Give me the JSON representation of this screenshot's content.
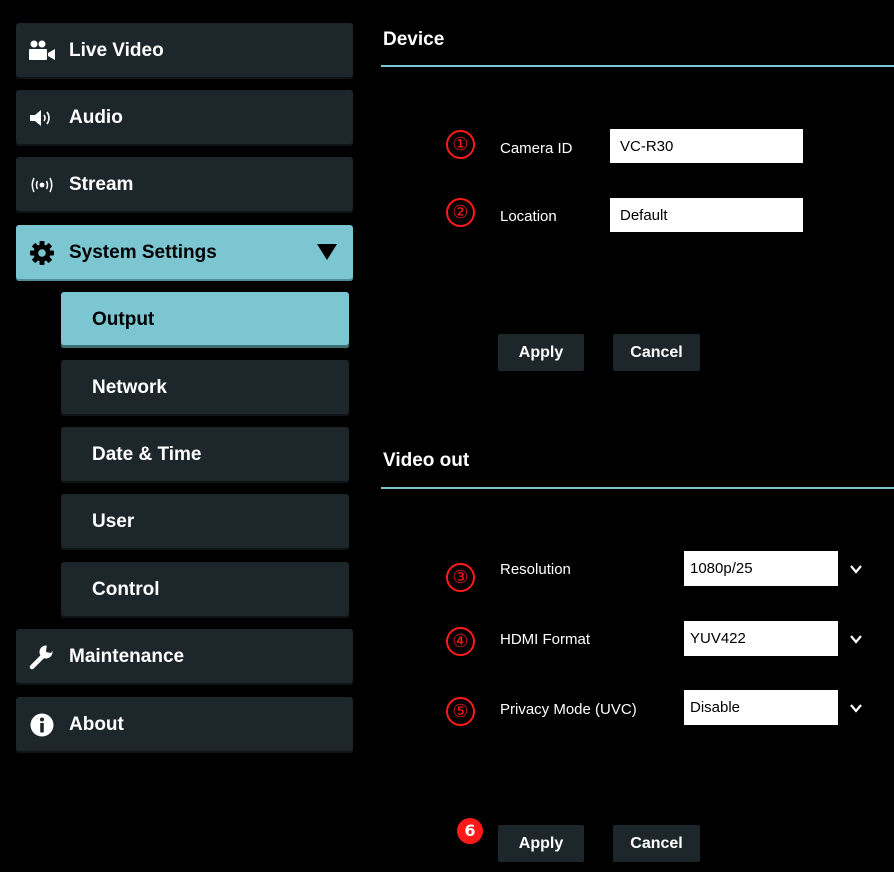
{
  "sidebar": {
    "items": [
      {
        "label": "Live Video",
        "icon": "video-camera-icon"
      },
      {
        "label": "Audio",
        "icon": "speaker-icon"
      },
      {
        "label": "Stream",
        "icon": "broadcast-icon"
      },
      {
        "label": "System Settings",
        "icon": "gear-icon",
        "expanded": true
      },
      {
        "label": "Maintenance",
        "icon": "wrench-icon"
      },
      {
        "label": "About",
        "icon": "info-icon"
      }
    ],
    "system_settings_sub": [
      {
        "label": "Output",
        "active": true
      },
      {
        "label": "Network"
      },
      {
        "label": "Date & Time"
      },
      {
        "label": "User"
      },
      {
        "label": "Control"
      }
    ]
  },
  "device": {
    "title": "Device",
    "camera_id": {
      "marker": "①",
      "label": "Camera ID",
      "value": "VC-R30"
    },
    "location": {
      "marker": "②",
      "label": "Location",
      "value": "Default"
    },
    "apply": "Apply",
    "cancel": "Cancel"
  },
  "video_out": {
    "title": "Video out",
    "resolution": {
      "marker": "③",
      "label": "Resolution",
      "value": "1080p/25"
    },
    "hdmi_format": {
      "marker": "④",
      "label": "HDMI Format",
      "value": "YUV422"
    },
    "privacy_mode": {
      "marker": "⑤",
      "label": "Privacy Mode (UVC)",
      "value": "Disable"
    },
    "apply_marker": "6",
    "apply": "Apply",
    "cancel": "Cancel"
  },
  "colors": {
    "accent": "#7cc6d2",
    "nav_bg": "#1d262b",
    "marker_red": "#ff1a1a",
    "background": "#000000"
  }
}
